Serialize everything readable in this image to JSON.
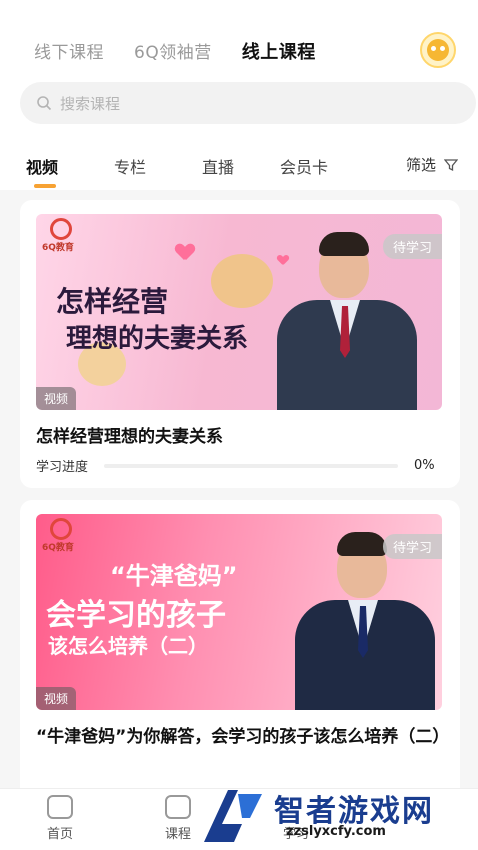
{
  "segments": [
    "线下课程",
    "6Q领袖营",
    "线上课程"
  ],
  "active_segment": 2,
  "search": {
    "placeholder": "搜索课程"
  },
  "tabs": [
    "视频",
    "专栏",
    "直播",
    "会员卡"
  ],
  "filter_label": "筛选",
  "courses": [
    {
      "status": "待学习",
      "type": "视频",
      "logo_text": "6Q教育",
      "headline_lines": [
        "怎样经营",
        "理想的夫妻关系"
      ],
      "title": "怎样经营理想的夫妻关系",
      "progress_label": "学习进度",
      "progress_value": "0%",
      "progress_fraction": 0
    },
    {
      "status": "待学习",
      "type": "视频",
      "logo_text": "6Q教育",
      "headline_lines": [
        "“牛津爸妈”",
        "会学习的孩子",
        "该怎么培养（二）"
      ],
      "title": "“牛津爸妈”为你解答，会学习的孩子该怎么培养（二）"
    }
  ],
  "bottom_nav": [
    "首页",
    "课程",
    "学习"
  ],
  "watermark": {
    "name": "智者游戏网",
    "url": "zzslyxcfy.com"
  },
  "colors": {
    "accent": "#f7a233",
    "watermark": "#1a3d8f"
  }
}
